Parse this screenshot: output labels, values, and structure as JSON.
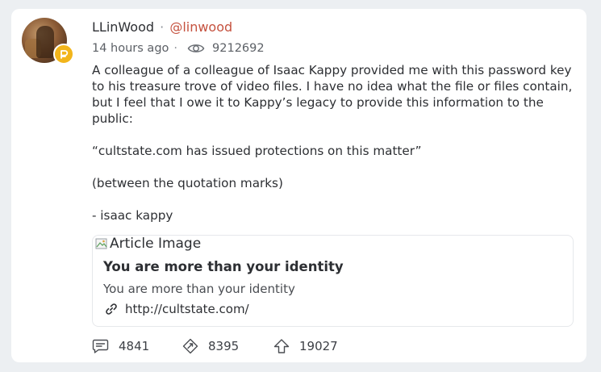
{
  "post": {
    "author_name": "LLinWood",
    "separator": "·",
    "handle": "@linwood",
    "time_ago": "14 hours ago",
    "view_count": "9212692",
    "body_paragraphs": [
      "A colleague of a colleague of Isaac Kappy provided me with this password key to his treasure trove of video files. I have no idea what the file or files contain, but I feel that I owe it to Kappy’s legacy to provide this information to the public:",
      "“cultstate.com has issued protections on this matter”",
      "(between the quotation marks)",
      "- isaac kappy"
    ]
  },
  "link_preview": {
    "image_alt": "Article Image",
    "title": "You are more than your identity",
    "description": "You are more than your identity",
    "url": "http://cultstate.com/"
  },
  "actions": {
    "comments": "4841",
    "reposts": "8395",
    "upvotes": "19027"
  },
  "colors": {
    "handle": "#c5523f",
    "badge": "#f2b51b"
  },
  "icons": [
    "eye-icon",
    "chain-link-icon",
    "comment-icon",
    "repost-icon",
    "upvote-icon",
    "verified-badge-icon"
  ]
}
